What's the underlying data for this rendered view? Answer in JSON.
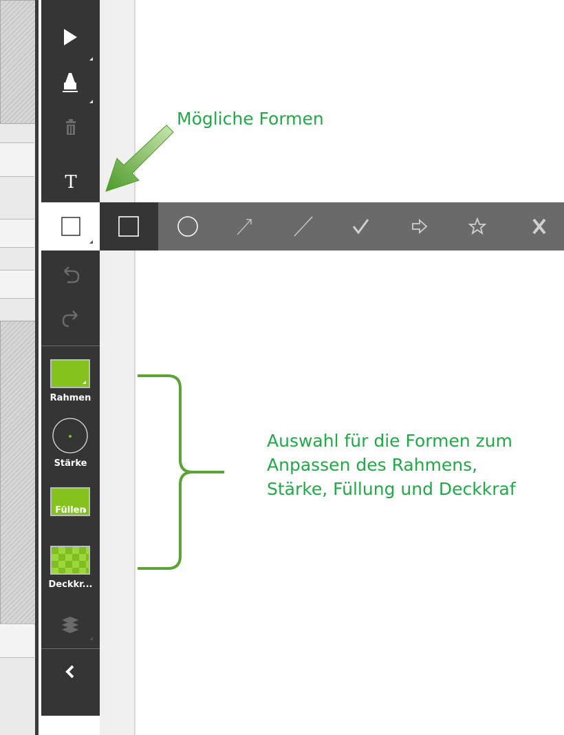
{
  "toolbar": {
    "tools": [
      {
        "name": "select",
        "icon": "pointer-arrow-icon"
      },
      {
        "name": "pen",
        "icon": "marker-icon"
      },
      {
        "name": "delete",
        "icon": "trash-icon"
      },
      {
        "name": "text",
        "icon": "text-icon",
        "label": "T"
      },
      {
        "name": "shape",
        "icon": "square-shape-icon",
        "selected": true
      },
      {
        "name": "undo",
        "icon": "undo-icon"
      },
      {
        "name": "redo",
        "icon": "redo-icon"
      }
    ],
    "options": {
      "border_label": "Rahmen",
      "stroke_label": "Stärke",
      "fill_label": "Füllen",
      "opacity_label": "Deckkr...",
      "color": "#84c21f"
    },
    "layers_icon": "layers-icon",
    "collapse_icon": "chevron-left-icon"
  },
  "shapes_bar": {
    "shapes": [
      "square-icon",
      "circle-icon",
      "arrow-line-icon",
      "line-icon",
      "checkmark-icon",
      "arrow-right-icon",
      "star-icon",
      "cross-icon"
    ],
    "selected": "square-icon"
  },
  "annotations": {
    "shapes_title": "Mögliche Formen",
    "options_lines": [
      "Auswahl für die Formen zum",
      "Anpassen des Rahmens,",
      "Stärke, Füllung und Deckkraf"
    ],
    "annotation_color": "#1faa46"
  }
}
